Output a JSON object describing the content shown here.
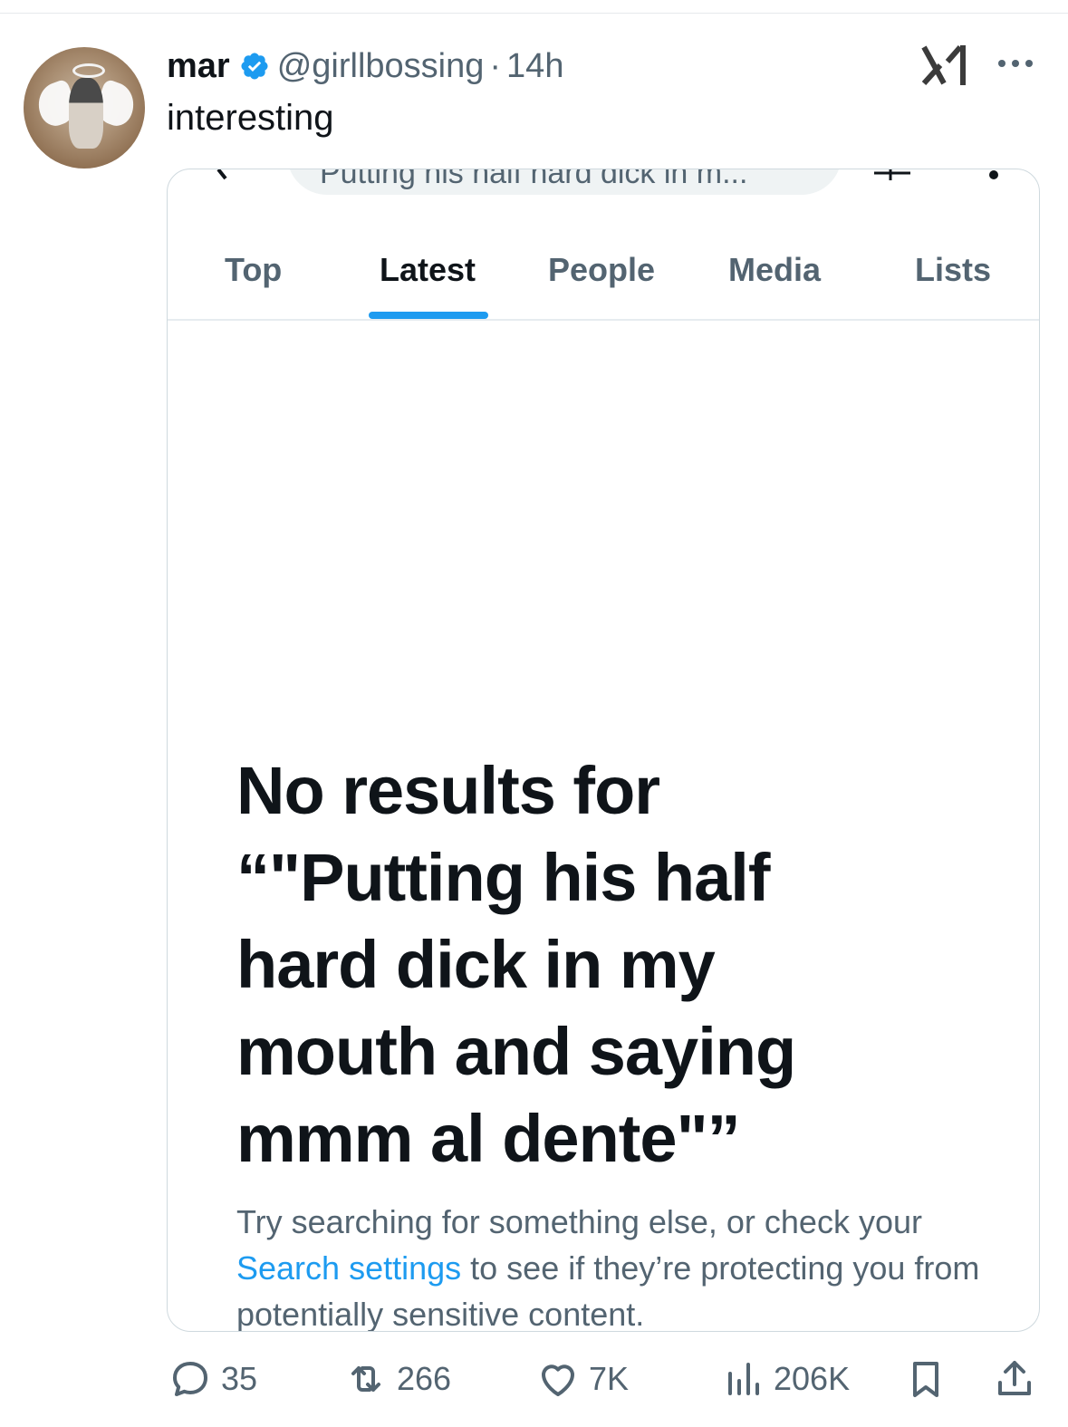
{
  "tweet": {
    "display_name": "mar",
    "handle": "@girllbossing",
    "separator": "·",
    "time": "14h",
    "text": "interesting"
  },
  "screenshot": {
    "search_query": "Putting his half hard dick in m...",
    "tabs": [
      {
        "label": "Top",
        "active": false
      },
      {
        "label": "Latest",
        "active": true
      },
      {
        "label": "People",
        "active": false
      },
      {
        "label": "Media",
        "active": false
      },
      {
        "label": "Lists",
        "active": false
      }
    ],
    "no_results_title": "No results for “\"Putting his half hard dick in my mouth and saying mmm al dente\"”",
    "hint_before": "Try searching for something else, or check your ",
    "hint_link": "Search settings",
    "hint_after": " to see if they’re protecting you from potentially sensitive content."
  },
  "actions": {
    "replies": "35",
    "retweets": "266",
    "likes": "7K",
    "views": "206K"
  },
  "colors": {
    "accent": "#1d9bf0",
    "text_primary": "#0f1419",
    "text_secondary": "#536471"
  }
}
